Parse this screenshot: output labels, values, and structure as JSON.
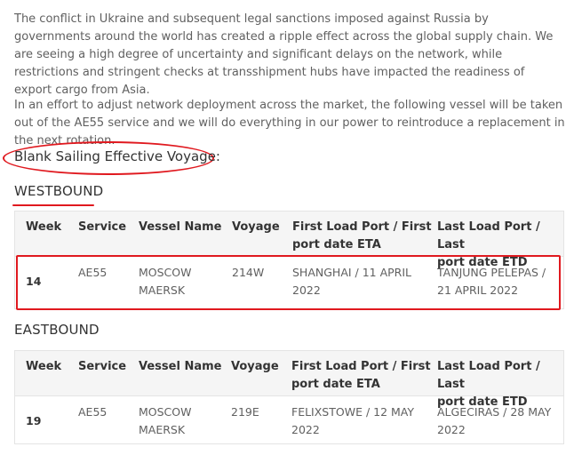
{
  "paragraphs": {
    "p1": "The conflict in Ukraine and subsequent legal sanctions imposed against Russia by governments around the world has created a ripple effect across the global supply chain. We are seeing a high degree of uncertainty and significant delays on the network, while restrictions and stringent checks at transshipment hubs have impacted the readiness of export cargo from Asia.",
    "p2": "In an effort to adjust network deployment across the market, the following vessel will be taken out of the AE55 service and we will do everything in our power to reintroduce a replacement in the next rotation."
  },
  "blank_sailing_title": "Blank Sailing Effective Voyage:",
  "headers": {
    "week": "Week",
    "service": "Service",
    "vessel_name": "Vessel Name",
    "voyage": "Voyage",
    "first_load_1": "First Load Port / First",
    "first_load_2": "port date ETA",
    "last_load_1": "Last Load Port / Last",
    "last_load_2": "port date ETD"
  },
  "westbound": {
    "title": "WESTBOUND",
    "row": {
      "week": "14",
      "service": "AE55",
      "vessel_1": "MOSCOW",
      "vessel_2": "MAERSK",
      "voyage": "214W",
      "first_1": "SHANGHAI / 11 APRIL",
      "first_2": "2022",
      "last_1": "TANJUNG PELEPAS /",
      "last_2": "21 APRIL 2022"
    }
  },
  "eastbound": {
    "title": "EASTBOUND",
    "row": {
      "week": "19",
      "service": "AE55",
      "vessel_1": "MOSCOW",
      "vessel_2": "MAERSK",
      "voyage": "219E",
      "first_1": "FELIXSTOWE / 12 MAY",
      "first_2": "2022",
      "last_1": "ALGECIRAS / 28 MAY",
      "last_2": "2022"
    }
  },
  "colors": {
    "annotation_red": "#e0191f",
    "header_bg": "#f5f5f5",
    "text": "#606060"
  }
}
